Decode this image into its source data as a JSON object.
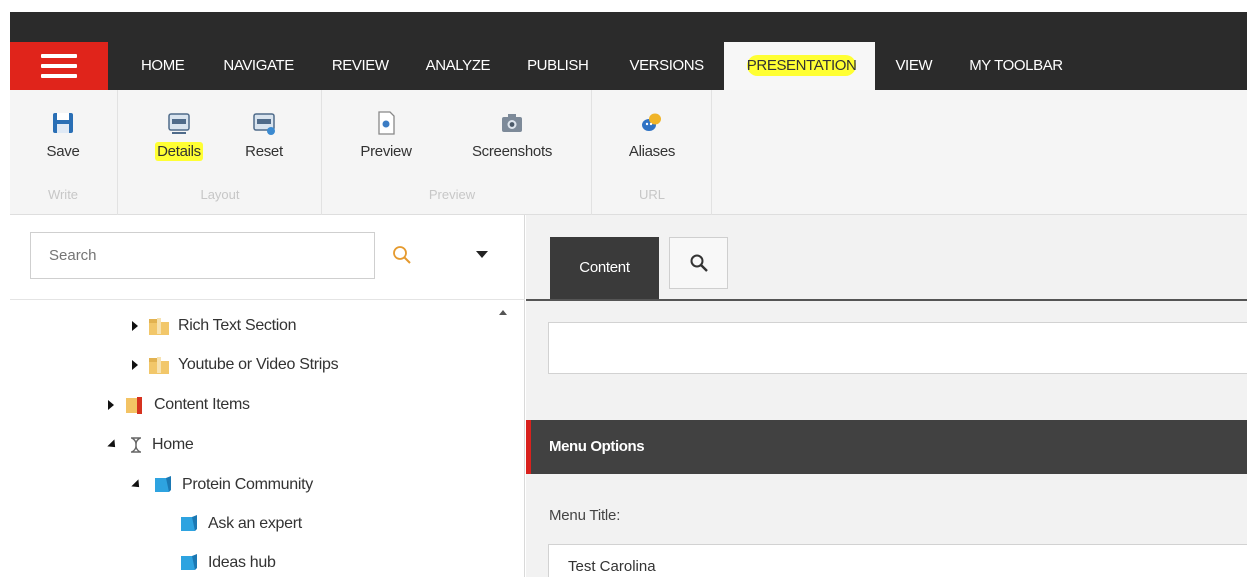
{
  "menu": {
    "tabs": [
      {
        "label": "HOME"
      },
      {
        "label": "NAVIGATE"
      },
      {
        "label": "REVIEW"
      },
      {
        "label": "ANALYZE"
      },
      {
        "label": "PUBLISH"
      },
      {
        "label": "VERSIONS"
      },
      {
        "label": "PRESENTATION",
        "active": true,
        "highlighted": true
      },
      {
        "label": "VIEW"
      },
      {
        "label": "MY TOOLBAR"
      }
    ]
  },
  "ribbon": {
    "groups": [
      {
        "label": "Write",
        "buttons": [
          {
            "label": "Save",
            "icon": "save-icon"
          }
        ]
      },
      {
        "label": "Layout",
        "buttons": [
          {
            "label": "Details",
            "icon": "layout-details-icon",
            "highlighted": true
          },
          {
            "label": "Reset",
            "icon": "layout-reset-icon"
          }
        ]
      },
      {
        "label": "Preview",
        "buttons": [
          {
            "label": "Preview",
            "icon": "preview-icon"
          },
          {
            "label": "Screenshots",
            "icon": "camera-icon"
          }
        ]
      },
      {
        "label": "URL",
        "buttons": [
          {
            "label": "Aliases",
            "icon": "masks-icon"
          }
        ]
      }
    ]
  },
  "tree": {
    "search_placeholder": "Search",
    "items": [
      {
        "label": "Rich Text Section",
        "icon": "folder-icon"
      },
      {
        "label": "Youtube or Video Strips",
        "icon": "folder-icon"
      },
      {
        "label": "Content Items",
        "icon": "flag-icon"
      },
      {
        "label": "Home",
        "icon": "home-node-icon"
      },
      {
        "label": "Protein Community",
        "icon": "page-icon"
      },
      {
        "label": "Ask an expert",
        "icon": "page-icon"
      },
      {
        "label": "Ideas hub",
        "icon": "page-icon"
      }
    ]
  },
  "editor": {
    "content_tab": "Content",
    "section_title": "Menu Options",
    "menu_title_label": "Menu Title:",
    "menu_title_value": "Test Carolina"
  },
  "colors": {
    "menubar": "#2b2b2b",
    "accent_red": "#e0241b",
    "highlight": "#ffff33",
    "section_bar": "#414141"
  }
}
